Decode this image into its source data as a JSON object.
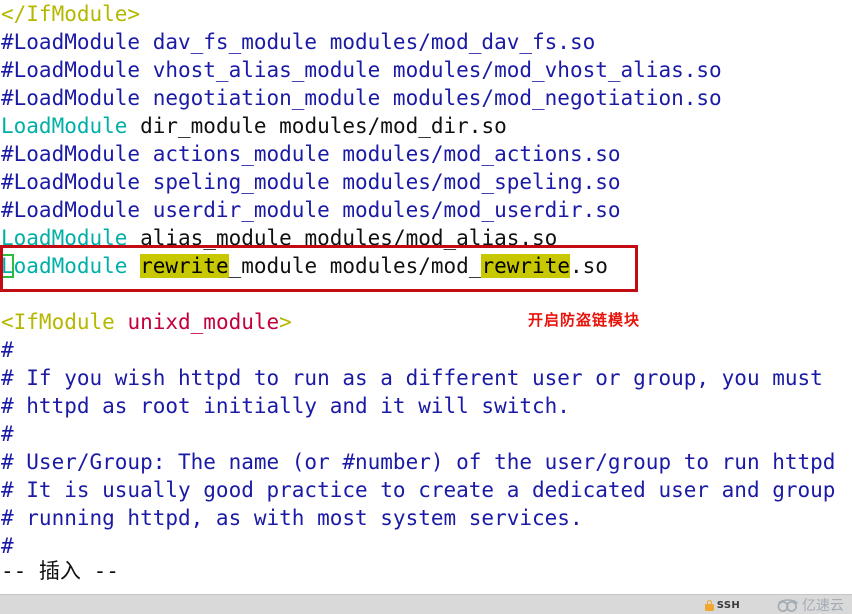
{
  "editor": {
    "app": "vim",
    "mode_line": "-- 插入 --",
    "lines": [
      {
        "id": "l1",
        "segments": [
          {
            "text": "</IfModule>",
            "type": "tag"
          }
        ]
      },
      {
        "id": "l2",
        "segments": [
          {
            "text": "#LoadModule dav_fs_module modules/mod_dav_fs.so",
            "type": "comment"
          }
        ]
      },
      {
        "id": "l3",
        "segments": [
          {
            "text": "#LoadModule vhost_alias_module modules/mod_vhost_alias.so",
            "type": "comment"
          }
        ]
      },
      {
        "id": "l4",
        "segments": [
          {
            "text": "#LoadModule negotiation_module modules/mod_negotiation.so",
            "type": "comment"
          }
        ]
      },
      {
        "id": "l5",
        "segments": [
          {
            "text": "LoadModule",
            "type": "directive"
          },
          {
            "text": " dir_module modules/mod_dir.so",
            "type": "plain"
          }
        ]
      },
      {
        "id": "l6",
        "segments": [
          {
            "text": "#LoadModule actions_module modules/mod_actions.so",
            "type": "comment"
          }
        ]
      },
      {
        "id": "l7",
        "segments": [
          {
            "text": "#LoadModule speling_module modules/mod_speling.so",
            "type": "comment"
          }
        ]
      },
      {
        "id": "l8",
        "segments": [
          {
            "text": "#LoadModule userdir_module modules/mod_userdir.so",
            "type": "comment"
          }
        ]
      },
      {
        "id": "l9",
        "segments": [
          {
            "text": "LoadModule",
            "type": "directive"
          },
          {
            "text": " alias_module modules/mod_alias.so",
            "type": "plain"
          }
        ]
      },
      {
        "id": "l10",
        "segments": [
          {
            "text": "L",
            "type": "directive",
            "cursor": true
          },
          {
            "text": "oadModule ",
            "type": "directive"
          },
          {
            "text": "rewrite",
            "type": "highlight"
          },
          {
            "text": "_module modules/mod_",
            "type": "plain"
          },
          {
            "text": "rewrite",
            "type": "highlight"
          },
          {
            "text": ".so",
            "type": "plain"
          }
        ]
      },
      {
        "id": "l11",
        "segments": [
          {
            "text": "",
            "type": "plain"
          }
        ]
      },
      {
        "id": "l12",
        "segments": [
          {
            "text": "<IfModule",
            "type": "tag"
          },
          {
            "text": " ",
            "type": "plain"
          },
          {
            "text": "unixd_module",
            "type": "arg"
          },
          {
            "text": ">",
            "type": "tag"
          }
        ]
      },
      {
        "id": "l13",
        "segments": [
          {
            "text": "#",
            "type": "comment"
          }
        ]
      },
      {
        "id": "l14",
        "segments": [
          {
            "text": "# If you wish httpd to run as a different user or group, you must",
            "type": "comment"
          }
        ]
      },
      {
        "id": "l15",
        "segments": [
          {
            "text": "# httpd as root initially and it will switch.",
            "type": "comment"
          }
        ]
      },
      {
        "id": "l16",
        "segments": [
          {
            "text": "#",
            "type": "comment"
          }
        ]
      },
      {
        "id": "l17",
        "segments": [
          {
            "text": "# User/Group: The name (or #number) of the user/group to run httpd",
            "type": "comment"
          }
        ]
      },
      {
        "id": "l18",
        "segments": [
          {
            "text": "# It is usually good practice to create a dedicated user and group",
            "type": "comment"
          }
        ]
      },
      {
        "id": "l19",
        "segments": [
          {
            "text": "# running httpd, as with most system services.",
            "type": "comment"
          }
        ]
      },
      {
        "id": "l20",
        "segments": [
          {
            "text": "#",
            "type": "comment"
          }
        ]
      }
    ]
  },
  "annotation": {
    "label": "开启防盗链模块",
    "label_color": "#e8140c",
    "box_color": "#c20b12"
  },
  "colors": {
    "background": "#ffffff",
    "comment": "#1a1aa6",
    "directive": "#00b0a8",
    "plain": "#101010",
    "tag": "#b5b800",
    "arg": "#c3003c",
    "search_highlight_bg": "#c8c800",
    "cursor_outline": "#2bbd3c",
    "status_bar": "#d9d9d9"
  },
  "status_bar": {
    "ssh_label": "SSH",
    "lock_icon": "lock-icon",
    "watermark_text": "亿速云"
  }
}
